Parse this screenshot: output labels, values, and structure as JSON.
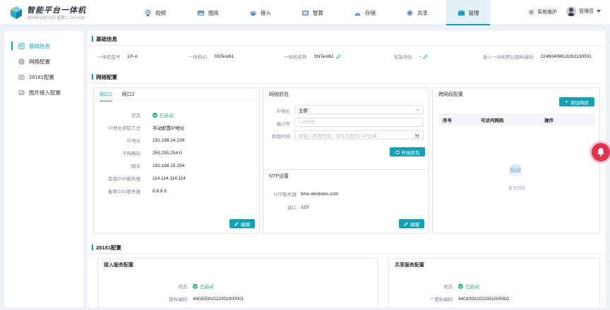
{
  "header": {
    "title": "智能平台一体机",
    "datetime": "2024年03月13日 星期二 16:14:09",
    "nav": [
      {
        "label": "视频",
        "icon": "video-icon"
      },
      {
        "label": "图库",
        "icon": "gallery-icon"
      },
      {
        "label": "接入",
        "icon": "access-icon"
      },
      {
        "label": "智算",
        "icon": "compute-icon"
      },
      {
        "label": "存储",
        "icon": "storage-icon"
      },
      {
        "label": "共享",
        "icon": "share-icon"
      },
      {
        "label": "管理",
        "icon": "manage-icon",
        "active": true
      }
    ],
    "system_maintenance": "系统维护",
    "user_name": "管理员"
  },
  "sidebar": {
    "items": [
      {
        "label": "基础信息",
        "icon": "info-icon",
        "active": true
      },
      {
        "label": "网络配置",
        "icon": "globe-icon"
      },
      {
        "label": "28181配置",
        "icon": "config-icon"
      },
      {
        "label": "图片接入配置",
        "icon": "image-icon"
      }
    ]
  },
  "basic_info": {
    "title": "基础信息",
    "model_label": "一体机型号",
    "model_value": "LP-A",
    "id_label": "一体机ID",
    "id_value": "SNTest61",
    "name_label": "一体机名称",
    "name_value": "SNTest61",
    "address_label": "安装地址",
    "address_value": "-",
    "code_label": "接入一体机默认国标编码",
    "code_value": "22460409613263130001"
  },
  "network": {
    "title": "网络配置",
    "tabs": [
      "网口1",
      "网口2"
    ],
    "status_label": "状态",
    "status_value": "已启动",
    "ip_mode_label": "IP地址获取方式",
    "ip_mode_value": "手动配置IP地址",
    "ip_label": "IP地址",
    "ip_value": "192.168.14.239",
    "mask_label": "子网掩码",
    "mask_value": "255.255.254.0",
    "gateway_label": "网关",
    "gateway_value": "192.168.15.254",
    "dns1_label": "首选DNS服务器",
    "dns1_value": "114.114.114.114",
    "dns2_label": "备用DNS服务器",
    "dns2_value": "8.8.8.8",
    "edit_label": "编辑"
  },
  "capture": {
    "title": "网络抓包",
    "ip_label": "IP地址",
    "ip_value": "全部",
    "port_label": "端口号",
    "port_placeholder": "1-65535",
    "time_label": "抓取时间",
    "time_placeholder": "请输入抓取时间，填写范围为1-60分钟",
    "time_unit": "分",
    "start_label": "开始抓包"
  },
  "ntp": {
    "title": "NTP设置",
    "server_label": "NTP服务器",
    "server_value": "time.windows.com",
    "port_label": "端口",
    "port_value": "123",
    "edit_label": "编辑"
  },
  "cross": {
    "title": "跨网段配置",
    "add_label": "添加网段",
    "col_index": "序号",
    "col_segment": "可访问网段",
    "col_action": "操作",
    "empty_text": "暂无网段"
  },
  "gb28181": {
    "title": "28181配置",
    "access_title": "接入服务配置",
    "access_status_label": "状态:",
    "access_status_value": "已启动",
    "access_code_label": "国标编码:",
    "access_code_value": "44030501022001000001",
    "share_title": "共享服务配置",
    "share_status_label": "状态:",
    "share_status_value": "已启动",
    "share_code_label": "国标编码:",
    "share_code_value": "44030501022001000002"
  },
  "colors": {
    "accent": "#16a0b5",
    "success": "#21b26c",
    "alert": "#e0334f"
  }
}
